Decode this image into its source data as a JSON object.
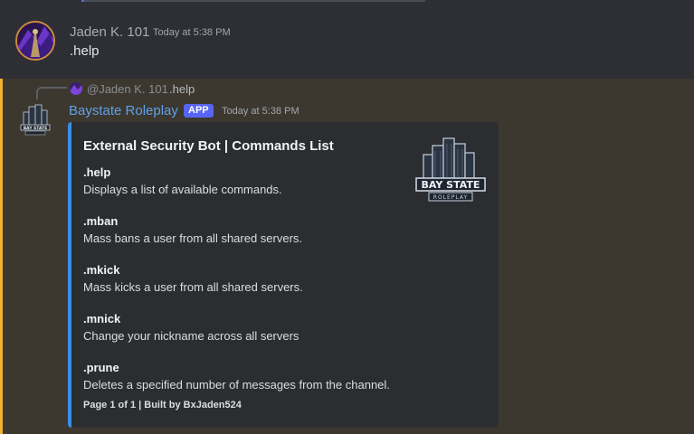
{
  "message1": {
    "username": "Jaden K. 101",
    "timestamp": "Today at 5:38 PM",
    "content": ".help"
  },
  "message2": {
    "reply": {
      "username": "@Jaden K. 101",
      "content": ".help"
    },
    "username": "Baystate Roleplay",
    "badge": "APP",
    "timestamp": "Today at 5:38 PM",
    "embed": {
      "accent_color": "#3b8ee6",
      "title": "External Security Bot | Commands List",
      "fields": [
        {
          "name": ".help",
          "value": "Displays a list of available commands."
        },
        {
          "name": ".mban",
          "value": "Mass bans a user from all shared servers."
        },
        {
          "name": ".mkick",
          "value": "Mass kicks a user from all shared servers."
        },
        {
          "name": ".mnick",
          "value": "Change your nickname across all servers"
        },
        {
          "name": ".prune",
          "value": "Deletes a specified number of messages from the channel."
        }
      ],
      "footer": "Page 1 of 1 | Built by BxJaden524",
      "thumbnail_text": [
        "BAY STATE",
        "ROLEPLAY"
      ]
    }
  }
}
